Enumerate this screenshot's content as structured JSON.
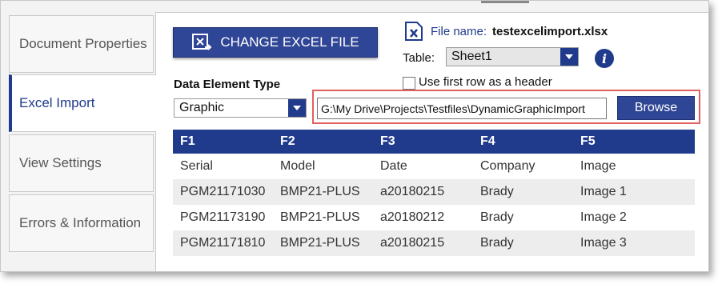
{
  "nav": {
    "items": [
      {
        "label": "Document Properties",
        "active": false
      },
      {
        "label": "Excel Import",
        "active": true
      },
      {
        "label": "View Settings",
        "active": false
      },
      {
        "label": "Errors & Information",
        "active": false
      }
    ]
  },
  "import": {
    "change_file_label": "CHANGE EXCEL FILE",
    "data_element_type_label": "Data Element Type",
    "data_element_type_value": "Graphic",
    "file_name_label": "File name:",
    "file_name_value": "testexcelimport.xlsx",
    "table_label": "Table:",
    "table_value": "Sheet1",
    "first_row_header_label": "Use first row as a header",
    "first_row_header_checked": false,
    "path_value": "G:\\My Drive\\Projects\\Testfiles\\DynamicGraphicImport",
    "browse_label": "Browse",
    "info_icon": "i"
  },
  "grid": {
    "columns": [
      "F1",
      "F2",
      "F3",
      "F4",
      "F5"
    ],
    "rows": [
      [
        "Serial",
        "Model",
        "Date",
        "Company",
        "Image"
      ],
      [
        "PGM21171030",
        "BMP21-PLUS",
        "a20180215",
        "Brady",
        "Image 1"
      ],
      [
        "PGM21173190",
        "BMP21-PLUS",
        "a20180212",
        "Brady",
        "Image 2"
      ],
      [
        "PGM21171810",
        "BMP21-PLUS",
        "a20180215",
        "Brady",
        "Image 3"
      ]
    ]
  },
  "colors": {
    "accent": "#203a8c",
    "button": "#2f4596",
    "highlight": "#e06060"
  }
}
